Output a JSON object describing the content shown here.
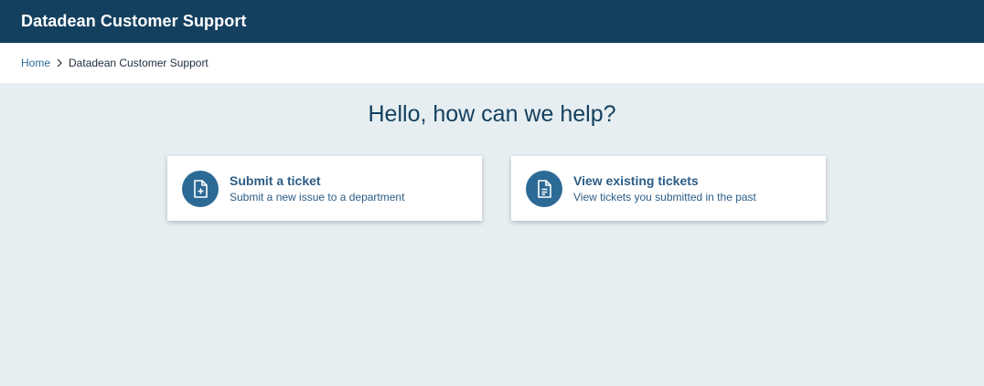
{
  "header": {
    "title": "Datadean Customer Support"
  },
  "breadcrumb": {
    "home": "Home",
    "current": "Datadean Customer Support"
  },
  "main": {
    "headline": "Hello, how can we help?",
    "cards": [
      {
        "title": "Submit a ticket",
        "subtitle": "Submit a new issue to a department",
        "icon": "file-plus-icon"
      },
      {
        "title": "View existing tickets",
        "subtitle": "View tickets you submitted in the past",
        "icon": "file-text-icon"
      }
    ]
  },
  "colors": {
    "header_bg": "#14405f",
    "page_bg": "#e6eef1",
    "accent": "#2c6a96"
  }
}
